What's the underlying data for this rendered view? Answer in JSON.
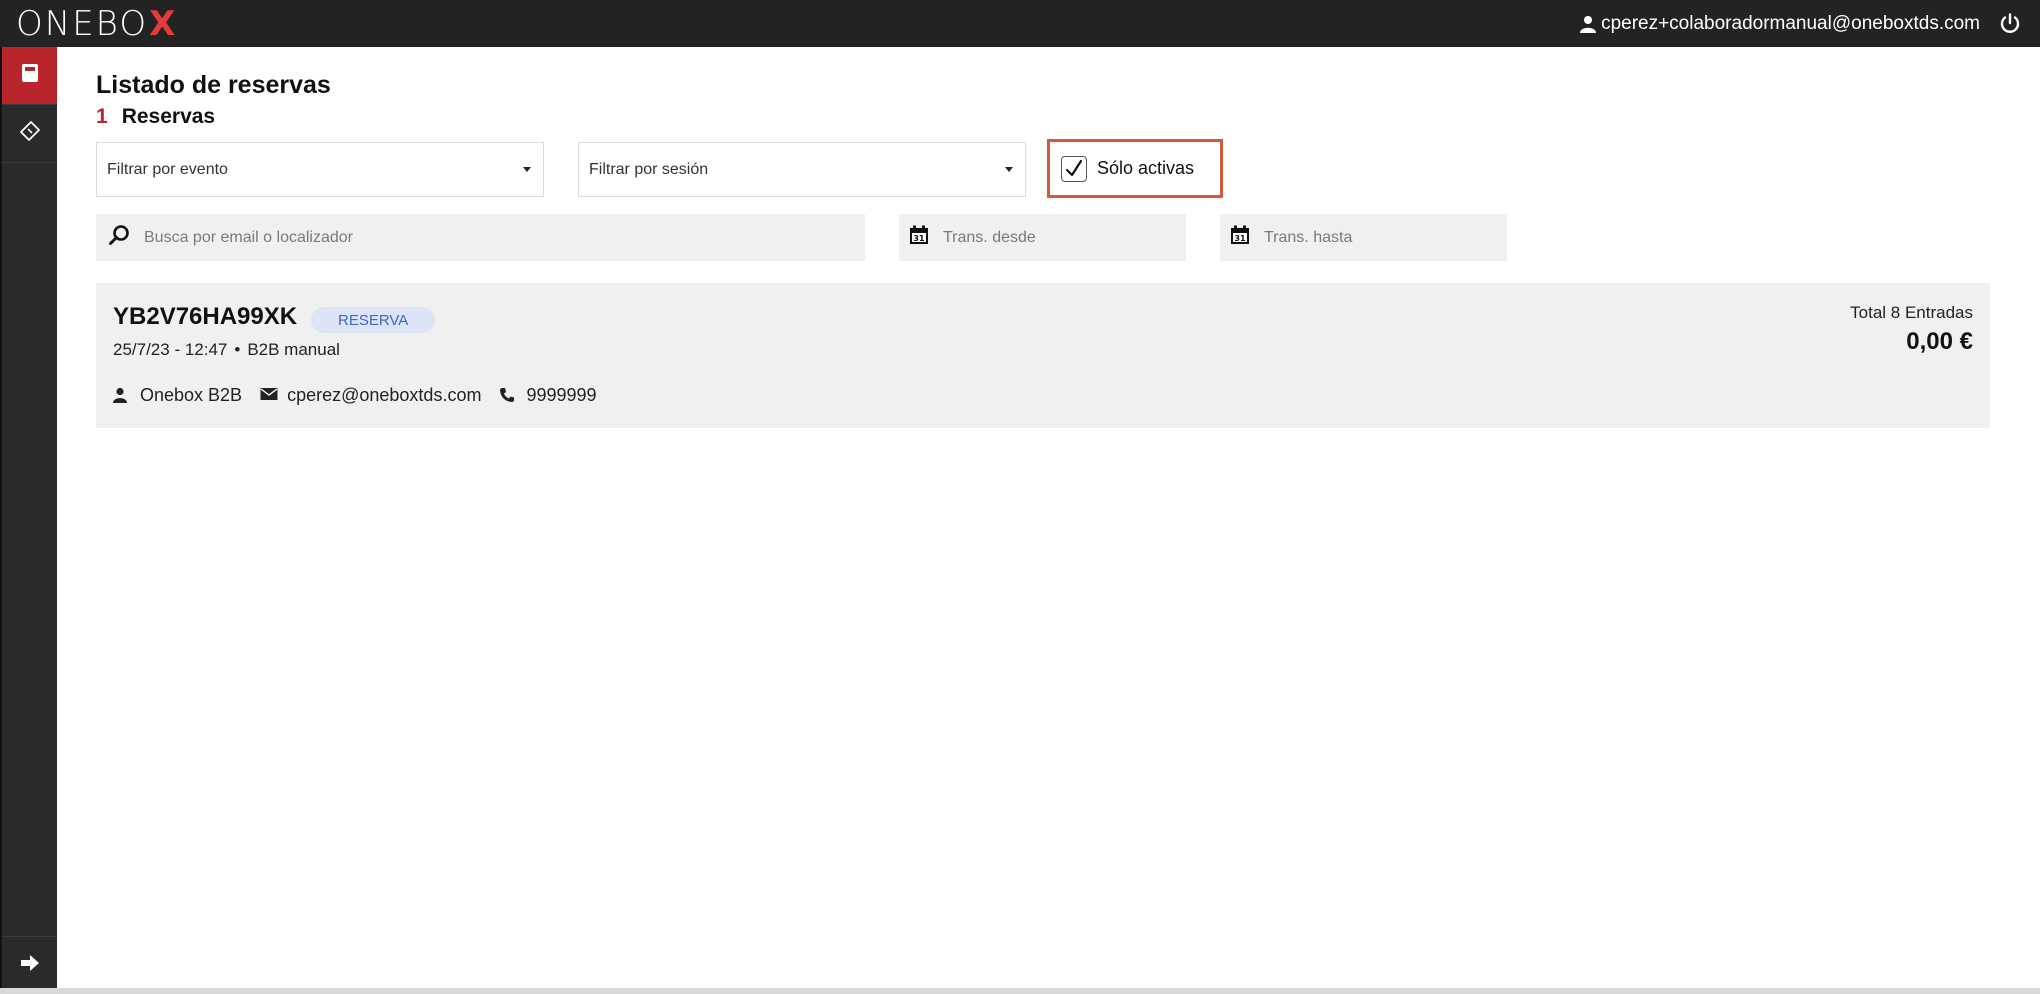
{
  "header": {
    "logo_text": "ONEBO",
    "logo_accent": "X",
    "user_email": "cperez+colaboradormanual@oneboxtds.com",
    "user_icon": "user-icon",
    "logout_icon": "power-icon"
  },
  "sidebar": {
    "items": [
      {
        "icon": "bookings-icon",
        "active": true
      },
      {
        "icon": "ticket-icon",
        "active": false
      }
    ],
    "bottom_icon": "arrow-right-icon"
  },
  "main": {
    "title": "Listado de reservas",
    "count": "1",
    "count_label": "Reservas",
    "filters": {
      "event_placeholder": "Filtrar por evento",
      "session_placeholder": "Filtrar por sesión",
      "only_active_label": "Sólo activas",
      "only_active_checked": true
    },
    "search": {
      "placeholder": "Busca por email o localizador",
      "value": ""
    },
    "date_from": {
      "placeholder": "Trans. desde",
      "value": ""
    },
    "date_to": {
      "placeholder": "Trans. hasta",
      "value": ""
    },
    "bookings": [
      {
        "locator": "YB2V76HA99XK",
        "badge": "RESERVA",
        "datetime": "25/7/23 - 12:47",
        "separator": "•",
        "channel": "B2B manual",
        "client_name": "Onebox B2B",
        "email": "cperez@oneboxtds.com",
        "phone": "9999999",
        "total_label": "Total 8 Entradas",
        "total_amount": "0,00 €"
      }
    ]
  },
  "colors": {
    "topbar": "#232323",
    "sidebar": "#2a2a2a",
    "accent_red": "#b8252c",
    "highlight_border": "#d9573a",
    "badge_bg": "#dde4f6",
    "badge_text": "#3d67c6",
    "card_bg": "#f0f0f0"
  }
}
